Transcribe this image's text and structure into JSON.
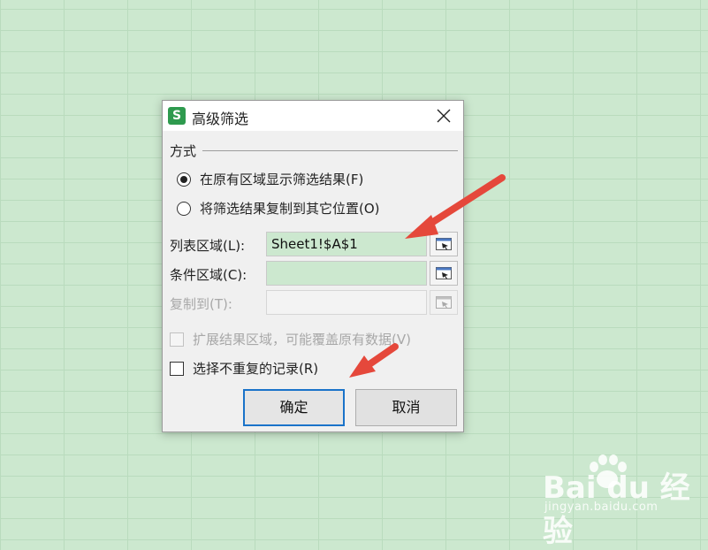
{
  "dialog": {
    "icon_letter": "S",
    "title": "高级筛选",
    "group_label": "方式",
    "radio_options": [
      {
        "label": "在原有区域显示筛选结果(F)",
        "selected": true
      },
      {
        "label": "将筛选结果复制到其它位置(O)",
        "selected": false
      }
    ],
    "fields": [
      {
        "label": "列表区域(L):",
        "value": "Sheet1!$A$1",
        "enabled": true
      },
      {
        "label": "条件区域(C):",
        "value": "",
        "enabled": true
      },
      {
        "label": "复制到(T):",
        "value": "",
        "enabled": false
      }
    ],
    "checkboxes": [
      {
        "label": "扩展结果区域，可能覆盖原有数据(V)",
        "checked": false,
        "enabled": false
      },
      {
        "label": "选择不重复的记录(R)",
        "checked": false,
        "enabled": true
      }
    ],
    "ok_label": "确定",
    "cancel_label": "取消"
  },
  "watermark": {
    "logo": "Bai du 经验",
    "url": "jingyan.baidu.com"
  },
  "colors": {
    "sheet_bg": "#cce8cf",
    "arrow": "#e5483b",
    "icon_green": "#2e9a4e",
    "focus_blue": "#1a73c9"
  }
}
